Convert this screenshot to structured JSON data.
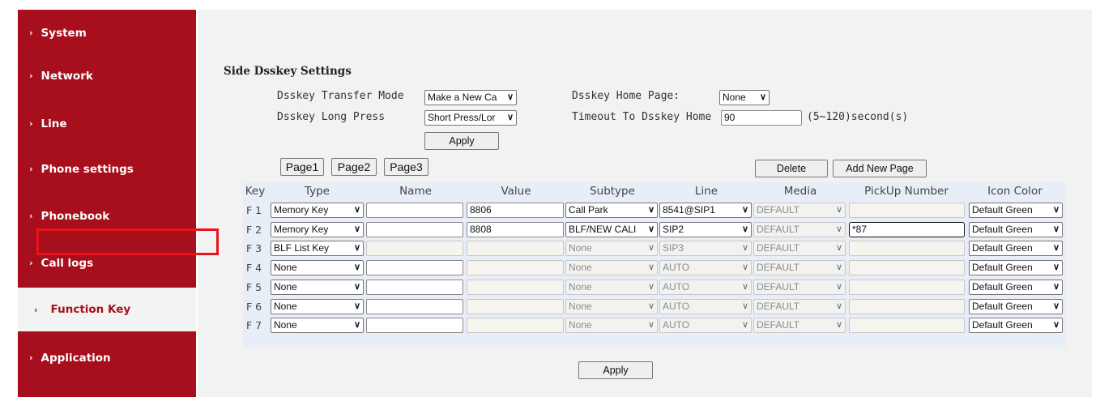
{
  "sidebar": {
    "items": [
      {
        "label": "System"
      },
      {
        "label": "Network"
      },
      {
        "label": "Line"
      },
      {
        "label": "Phone settings"
      },
      {
        "label": "Phonebook"
      },
      {
        "label": "Call logs"
      },
      {
        "label": "Function Key"
      },
      {
        "label": "Application"
      }
    ],
    "active": "Function Key"
  },
  "section_title": "Side Dsskey Settings",
  "settings": {
    "transfer_mode_label": "Dsskey Transfer Mode",
    "transfer_mode_value": "Make a New Ca",
    "long_press_label": "Dsskey Long Press",
    "long_press_value": "Short Press/Lor",
    "home_page_label": "Dsskey Home Page:",
    "home_page_value": "None",
    "timeout_label": "Timeout To Dsskey Home",
    "timeout_value": "90",
    "timeout_hint": "(5~120)second(s)",
    "apply_label": "Apply"
  },
  "pages": {
    "tabs": [
      "Page1",
      "Page2",
      "Page3"
    ],
    "delete_label": "Delete",
    "add_label": "Add New Page"
  },
  "table": {
    "headers": [
      "Key",
      "Type",
      "Name",
      "Value",
      "Subtype",
      "Line",
      "Media",
      "PickUp Number",
      "Icon Color"
    ],
    "rows": [
      {
        "key": "F 1",
        "type": "Memory Key",
        "name": "",
        "value": "8806",
        "subtype": "Call Park",
        "line": "8541@SIP1",
        "media": "DEFAULT",
        "pickup": "",
        "color": "Default Green"
      },
      {
        "key": "F 2",
        "type": "Memory Key",
        "name": "",
        "value": "8808",
        "subtype": "BLF/NEW CALI",
        "line": "SIP2",
        "media": "DEFAULT",
        "pickup": "*87",
        "color": "Default Green"
      },
      {
        "key": "F 3",
        "type": "BLF List Key",
        "name": "",
        "value": "",
        "subtype": "None",
        "line": "SIP3",
        "media": "DEFAULT",
        "pickup": "",
        "color": "Default Green"
      },
      {
        "key": "F 4",
        "type": "None",
        "name": "",
        "value": "",
        "subtype": "None",
        "line": "AUTO",
        "media": "DEFAULT",
        "pickup": "",
        "color": "Default Green"
      },
      {
        "key": "F 5",
        "type": "None",
        "name": "",
        "value": "",
        "subtype": "None",
        "line": "AUTO",
        "media": "DEFAULT",
        "pickup": "",
        "color": "Default Green"
      },
      {
        "key": "F 6",
        "type": "None",
        "name": "",
        "value": "",
        "subtype": "None",
        "line": "AUTO",
        "media": "DEFAULT",
        "pickup": "",
        "color": "Default Green"
      },
      {
        "key": "F 7",
        "type": "None",
        "name": "",
        "value": "",
        "subtype": "None",
        "line": "AUTO",
        "media": "DEFAULT",
        "pickup": "",
        "color": "Default Green"
      }
    ],
    "apply_label": "Apply"
  },
  "colors": {
    "brand": "#a80f1c",
    "highlight": "#e8131b",
    "table_bg": "#e8eef7"
  },
  "icons": {
    "nav": "chevron-right-icon",
    "select": "chevron-down-icon"
  }
}
